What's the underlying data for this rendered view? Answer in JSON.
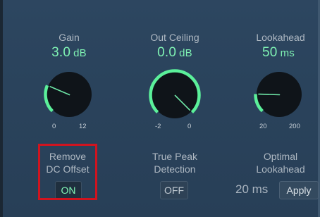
{
  "knobs": [
    {
      "label": "Gain",
      "value": "3.0",
      "unit": "dB",
      "min_tick": "0",
      "max_tick": "12",
      "level": 0.25
    },
    {
      "label": "Out Ceiling",
      "value": "0.0",
      "unit": "dB",
      "min_tick": "-2",
      "max_tick": "0",
      "level": 1.0
    },
    {
      "label": "Lookahead",
      "value": "50",
      "unit": "ms",
      "min_tick": "20",
      "max_tick": "200",
      "level": 0.17
    }
  ],
  "toggles": {
    "remove_dc_offset": {
      "label_line1": "Remove",
      "label_line2": "DC Offset",
      "state": "ON"
    },
    "true_peak_detection": {
      "label_line1": "True Peak",
      "label_line2": "Detection",
      "state": "OFF"
    },
    "optimal_lookahead": {
      "label_line1": "Optimal",
      "label_line2": "Lookahead",
      "value": "20 ms",
      "apply_label": "Apply"
    }
  },
  "colors": {
    "accent_green": "#7ff2b3",
    "arc_green": "#5bf09a",
    "highlight_red": "#d0141f",
    "background": "#2b445d"
  }
}
